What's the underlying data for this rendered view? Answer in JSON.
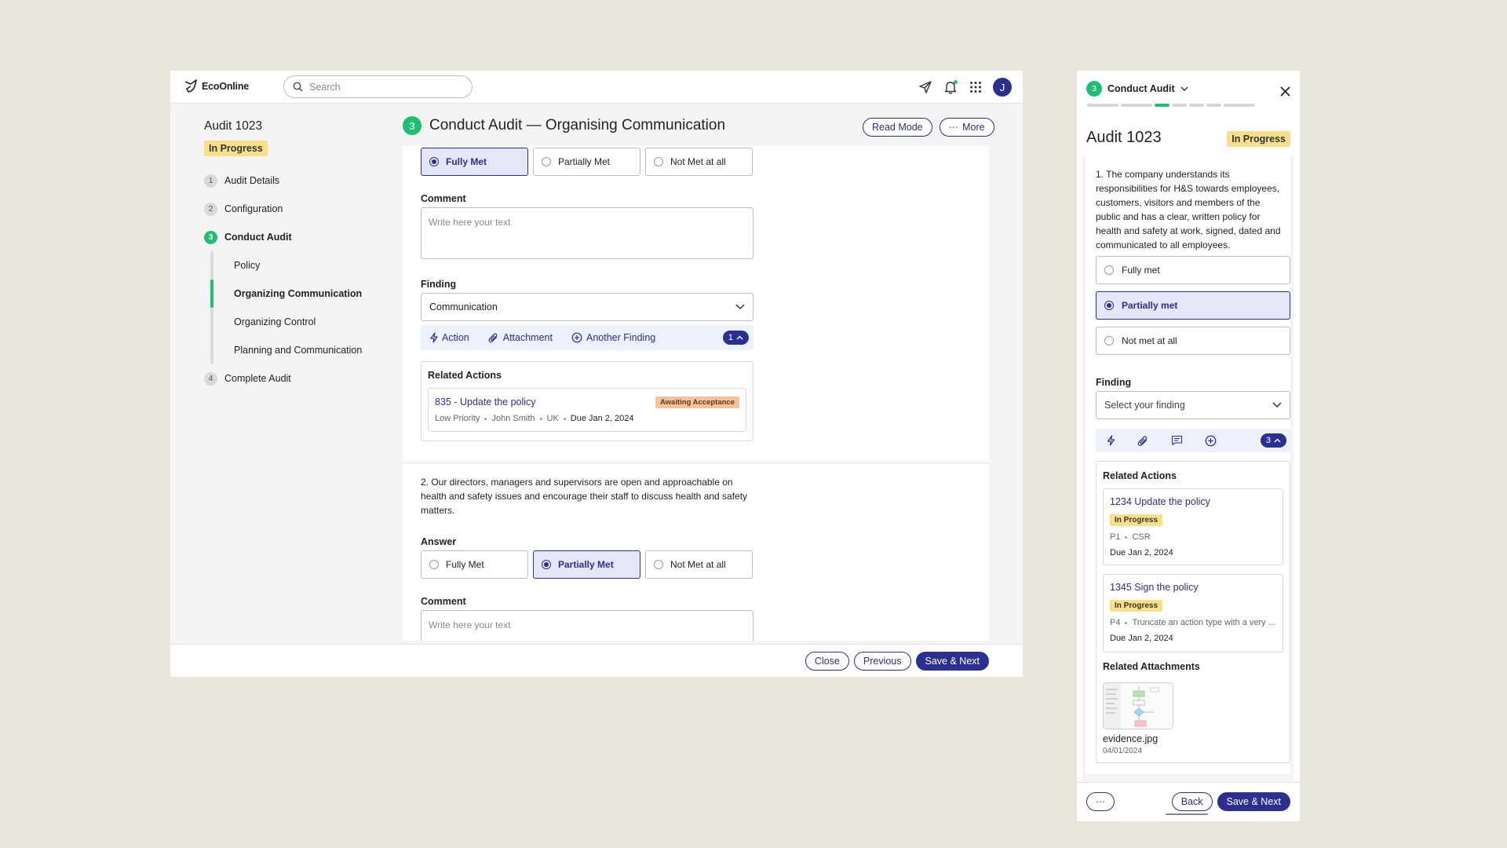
{
  "app": {
    "logo_text": "EcoOnline",
    "search_placeholder": "Search",
    "avatar_initial": "J"
  },
  "sidebar": {
    "audit_title": "Audit 1023",
    "status": "In Progress",
    "steps": [
      {
        "num": "1",
        "label": "Audit Details"
      },
      {
        "num": "2",
        "label": "Configuration"
      },
      {
        "num": "3",
        "label": "Conduct Audit"
      },
      {
        "num": "4",
        "label": "Complete Audit"
      }
    ],
    "substeps": [
      "Policy",
      "Organizing Communication",
      "Organizing Control",
      "Planning and Communication"
    ]
  },
  "header": {
    "step_num": "3",
    "title": "Conduct Audit — Organising Communication",
    "read_mode": "Read Mode",
    "more": "More"
  },
  "q1": {
    "answers": [
      "Fully Met",
      "Partially Met",
      "Not Met at all"
    ],
    "comment_label": "Comment",
    "comment_placeholder": "Write here your text",
    "finding_label": "Finding",
    "finding_value": "Communication",
    "toolbar": {
      "action": "Action",
      "attachment": "Attachment",
      "another": "Another Finding",
      "count": "1"
    },
    "related_title": "Related Actions",
    "action": {
      "title": "835 - Update the policy",
      "status": "Awaiting Acceptance",
      "priority": "Low Priority",
      "person": "John Smith",
      "region": "UK",
      "due": "Due Jan 2, 2024"
    }
  },
  "q2": {
    "text": "2. Our directors, managers and supervisors are open and approachable on health and safety issues and encourage their staff to discuss health and safety matters.",
    "answer_label": "Answer",
    "answers": [
      "Fully Met",
      "Partially Met",
      "Not Met at all"
    ],
    "comment_label": "Comment",
    "comment_placeholder": "Write here your text"
  },
  "footer": {
    "close": "Close",
    "previous": "Previous",
    "save_next": "Save & Next"
  },
  "panel": {
    "step_num": "3",
    "step_label": "Conduct Audit",
    "title": "Audit 1023",
    "status": "In Progress",
    "question": "1. The company understands its responsibilities for H&S towards employees, customers, visitors and members of the public and has a clear, written policy for health and safety at work, signed, dated and communicated to all employees.",
    "answers": [
      "Fully met",
      "Partially met",
      "Not met at all"
    ],
    "finding_label": "Finding",
    "finding_placeholder": "Select your finding",
    "count": "3",
    "related_actions_title": "Related Actions",
    "actions": [
      {
        "title": "1234 Update the policy",
        "status": "In Progress",
        "p": "P1",
        "type": "CSR",
        "due": "Due Jan 2, 2024"
      },
      {
        "title": "1345 Sign the policy",
        "status": "In Progress",
        "p": "P4",
        "type": "Truncate an action type with a very ...",
        "due": "Due Jan 2, 2024"
      }
    ],
    "attachments_title": "Related Attachments",
    "attachment": {
      "name": "evidence.jpg",
      "date": "04/01/2024"
    },
    "back": "Back",
    "save_next": "Save & Next"
  },
  "colors": {
    "accent": "#2b2f8f",
    "success": "#1fbf73",
    "warning": "#f8e08a",
    "orange": "#f6c29a"
  }
}
